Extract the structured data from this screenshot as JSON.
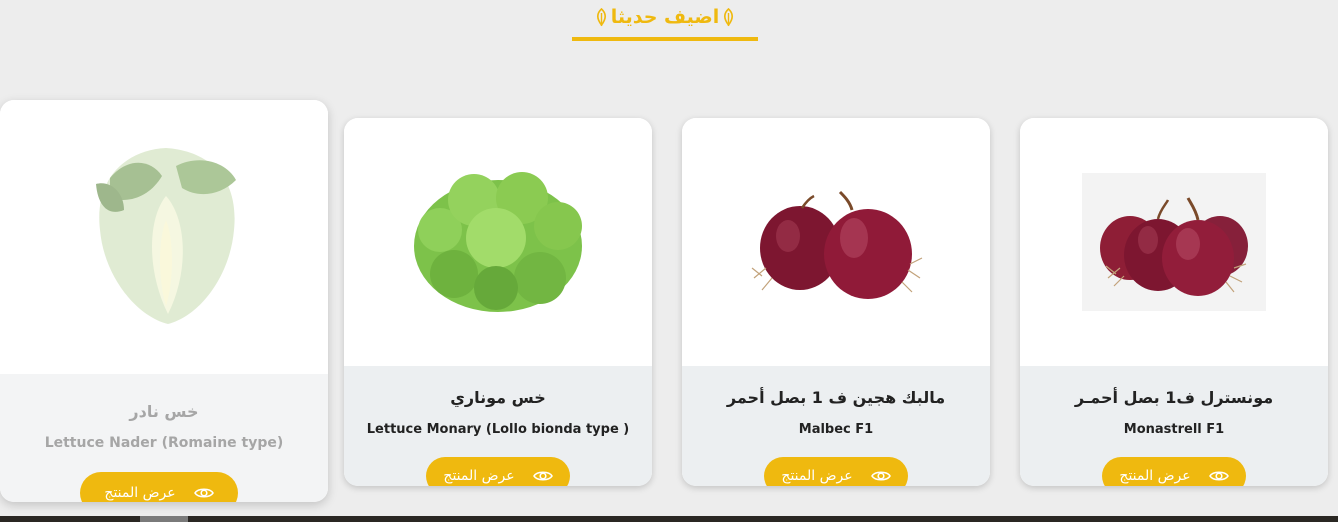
{
  "section": {
    "title": "اضيف حديثا",
    "accent_color": "#efb90f",
    "icon": "leaf-icon"
  },
  "products": [
    {
      "name_ar": "مونسترل ف1 بصل أحمـر",
      "name_en": "Monastrell F1",
      "button_label": "عرض المنتج",
      "image": "red-onion-image"
    },
    {
      "name_ar": "مالبك هجين ف 1 بصل أحمر",
      "name_en": "Malbec F1",
      "button_label": "عرض المنتج",
      "image": "red-onion-image"
    },
    {
      "name_ar": "خس موناري",
      "name_en": "Lettuce Monary (Lollo bionda type )",
      "button_label": "عرض المنتج",
      "image": "lollo-bionda-lettuce-image"
    },
    {
      "name_ar": "خس نادر",
      "name_en": "Lettuce Nader (Romaine type)",
      "button_label": "عرض المنتج",
      "image": "romaine-lettuce-image"
    }
  ]
}
